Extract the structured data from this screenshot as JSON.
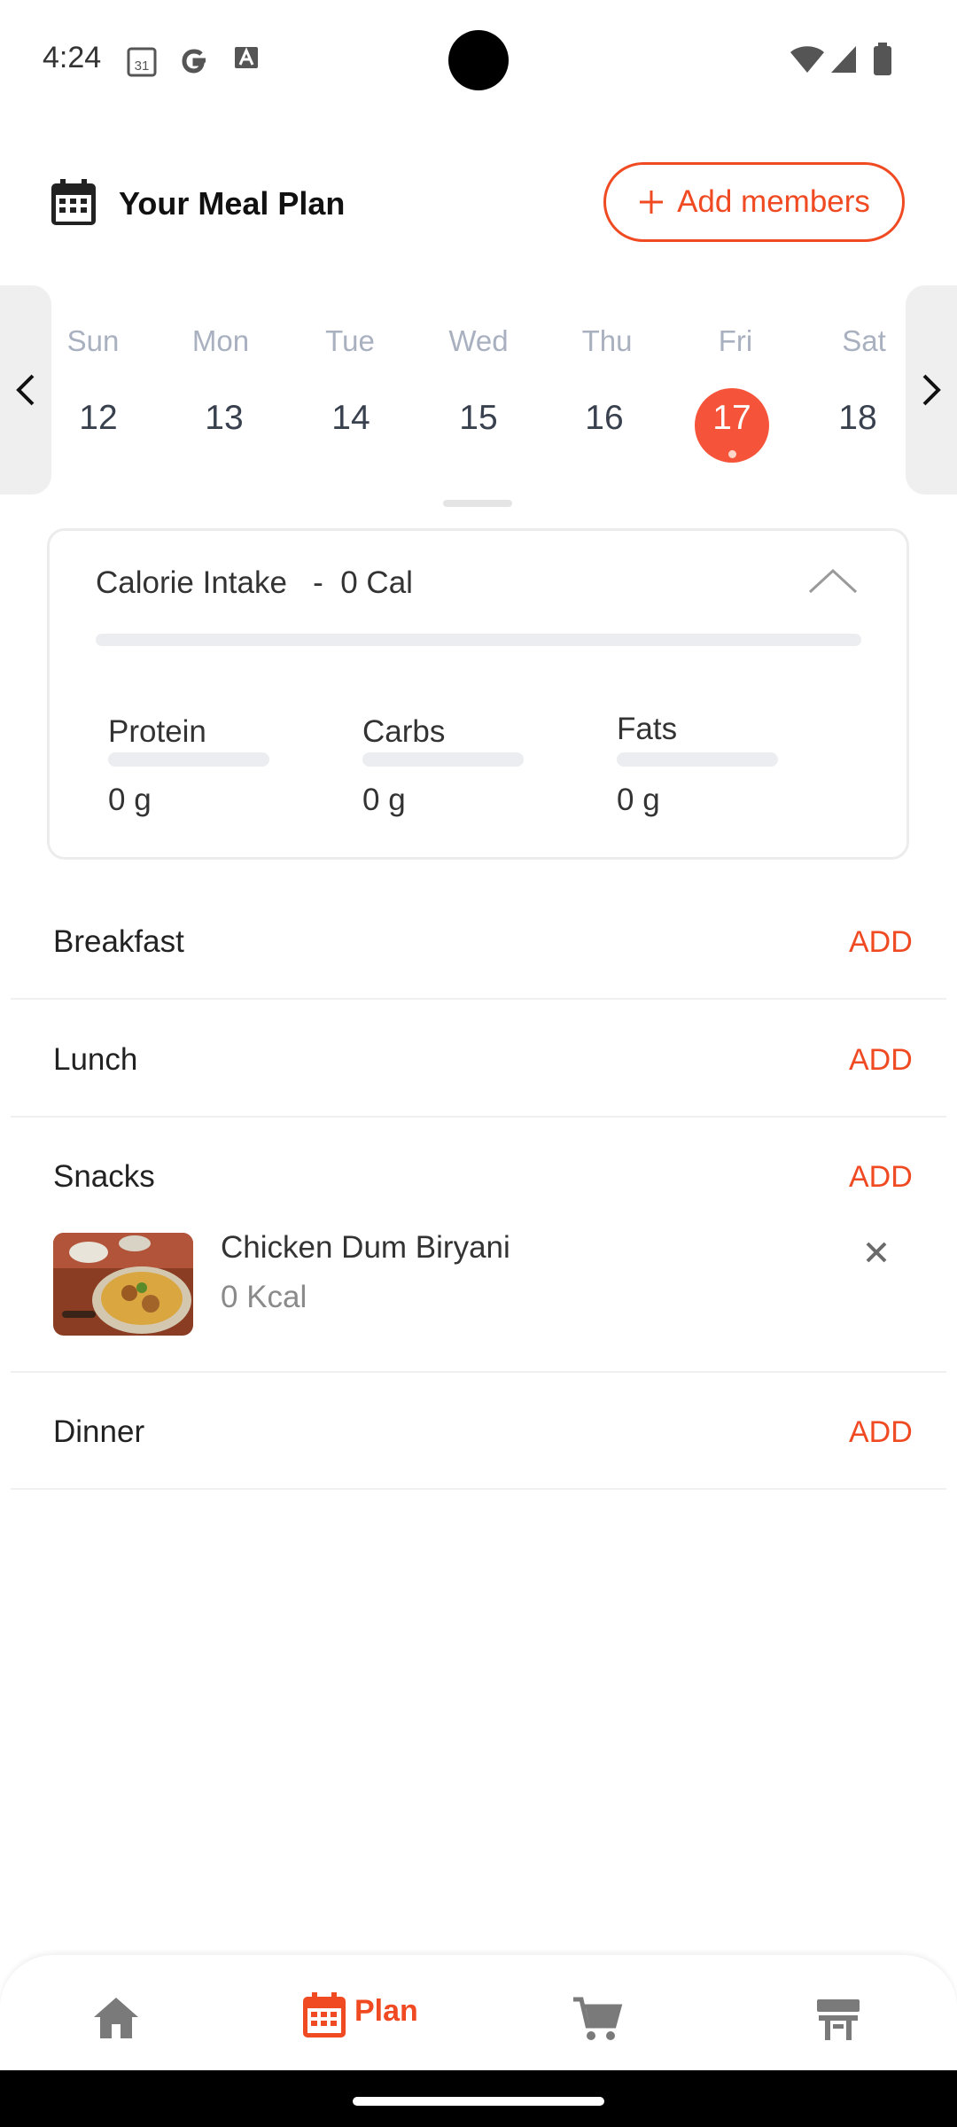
{
  "status_bar": {
    "time": "4:24",
    "calendar_icon_text": "31"
  },
  "header": {
    "title": "Your Meal Plan",
    "add_members_label": "Add members"
  },
  "week": {
    "days": [
      {
        "name": "Sun",
        "num": "12"
      },
      {
        "name": "Mon",
        "num": "13"
      },
      {
        "name": "Tue",
        "num": "14"
      },
      {
        "name": "Wed",
        "num": "15"
      },
      {
        "name": "Thu",
        "num": "16"
      },
      {
        "name": "Fri",
        "num": "17"
      },
      {
        "name": "Sat",
        "num": "18"
      }
    ],
    "selected_day": "17"
  },
  "calories": {
    "label": "Calorie Intake   -  0 Cal",
    "macros": [
      {
        "name": "Protein",
        "value": "0 g"
      },
      {
        "name": "Carbs",
        "value": "0 g"
      },
      {
        "name": "Fats",
        "value": "0 g"
      }
    ]
  },
  "meals": {
    "add_label": "ADD",
    "breakfast": "Breakfast",
    "lunch": "Lunch",
    "snacks": "Snacks",
    "dinner": "Dinner",
    "snack_items": [
      {
        "name": "Chicken Dum Biryani",
        "kcal": "0 Kcal"
      }
    ]
  },
  "bottom_nav": {
    "plan_label": "Plan"
  },
  "colors": {
    "accent": "#f04a22",
    "selected_day": "#f6543a"
  }
}
